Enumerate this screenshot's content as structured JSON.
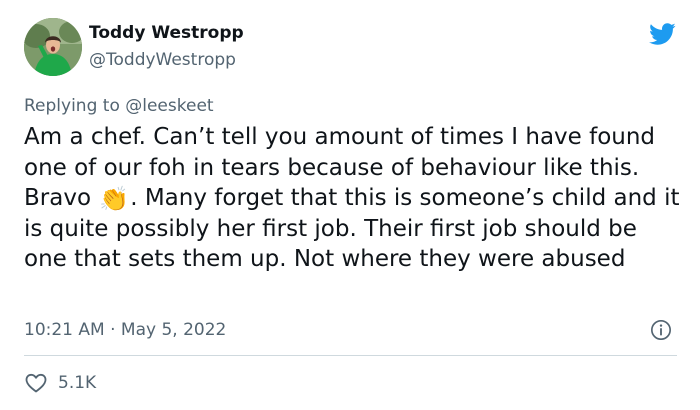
{
  "author": {
    "name": "Toddy Westropp",
    "handle": "@ToddyWestropp",
    "avatar_icon": "profile-photo"
  },
  "reply": {
    "prefix": "Replying to ",
    "mention": "@leeskeet"
  },
  "tweet": {
    "text_before_emoji": "Am a chef. Can’t tell you amount of times I have found one of our foh in tears because of behaviour like this. Bravo ",
    "emoji": "👏",
    "text_after_emoji": ". Many forget that this is someone’s child and it is quite possibly her first job. Their first job should be one that sets them up. Not where they were abused",
    "timestamp": "10:21 AM · May 5, 2022"
  },
  "stats": {
    "likes": "5.1K"
  },
  "icons": {
    "brand": "twitter-bird-icon",
    "info": "info-icon",
    "like": "heart-icon"
  },
  "colors": {
    "brand": "#1d9bf0",
    "text": "#0f1419",
    "secondary": "#536471",
    "divider": "#cfd9de"
  }
}
